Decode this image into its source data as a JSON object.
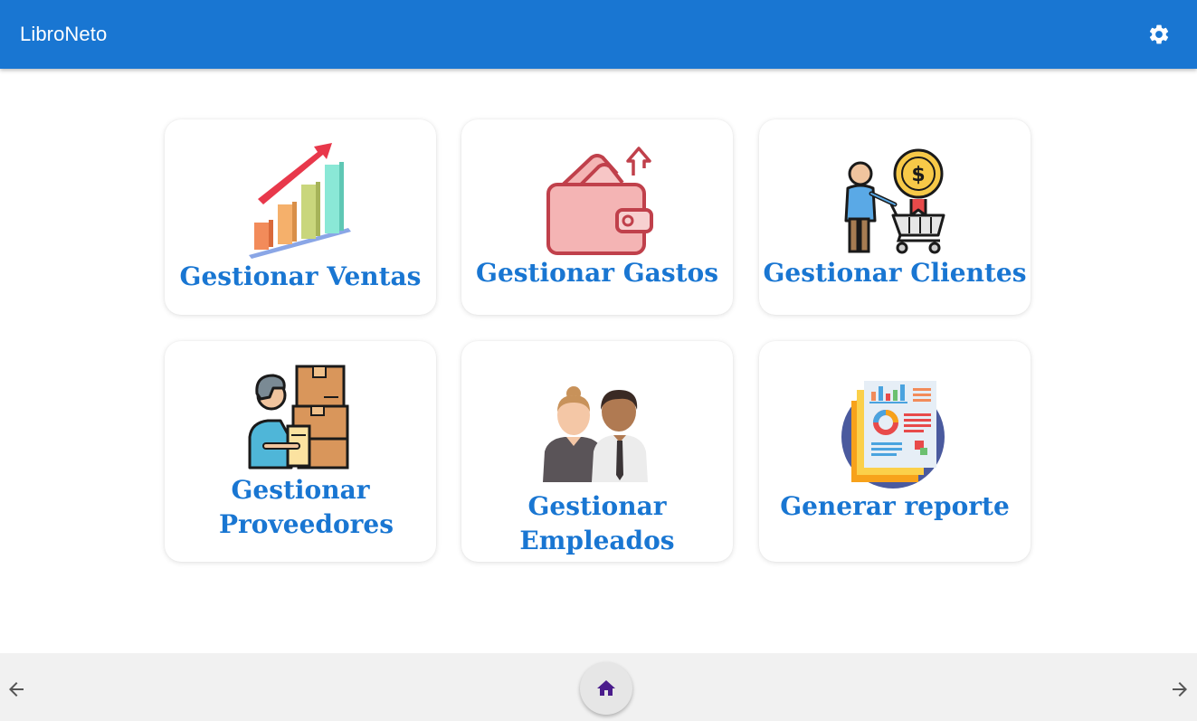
{
  "header": {
    "title": "LibroNeto",
    "settings_icon": "gear-icon"
  },
  "cards": [
    {
      "label": "Gestionar Ventas",
      "icon": "bar-chart-growth-icon"
    },
    {
      "label": "Gestionar Gastos",
      "icon": "wallet-icon"
    },
    {
      "label": "Gestionar Clientes",
      "icon": "customer-cart-icon"
    },
    {
      "label": "Gestionar Proveedores",
      "icon": "supplier-boxes-icon"
    },
    {
      "label": "Gestionar Empleados",
      "icon": "employees-icon"
    },
    {
      "label": "Generar reporte",
      "icon": "report-icon"
    }
  ],
  "bottom_nav": {
    "back_icon": "arrow-left-icon",
    "home_icon": "home-icon",
    "forward_icon": "arrow-right-icon"
  },
  "colors": {
    "primary": "#1976d2",
    "home_icon": "#4a1c8c",
    "bottom_bar": "#f1f1f1"
  }
}
